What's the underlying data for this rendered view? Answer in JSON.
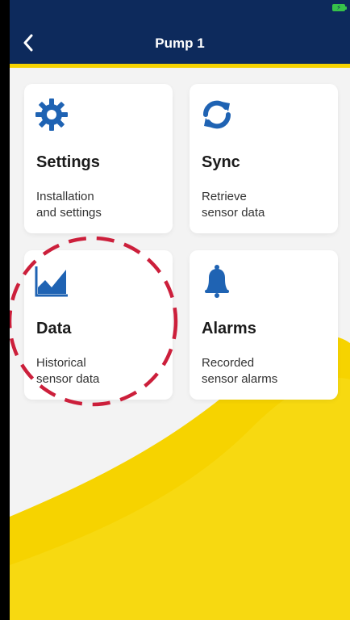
{
  "header": {
    "title": "Pump 1",
    "back_icon": "chevron-left-icon"
  },
  "status": {
    "battery_icon": "battery-charging-icon"
  },
  "colors": {
    "header_bg": "#0d2a5c",
    "accent_yellow": "#f6d300",
    "icon_blue": "#1f63b3",
    "annotation_red": "#cc1f3b"
  },
  "cards": [
    {
      "title": "Settings",
      "line1": "Installation",
      "line2": "and settings",
      "icon": "gear-icon"
    },
    {
      "title": "Sync",
      "line1": "Retrieve",
      "line2": "sensor data",
      "icon": "sync-icon"
    },
    {
      "title": "Data",
      "line1": "Historical",
      "line2": "sensor data",
      "icon": "chart-icon"
    },
    {
      "title": "Alarms",
      "line1": "Recorded",
      "line2": "sensor alarms",
      "icon": "bell-icon"
    }
  ]
}
